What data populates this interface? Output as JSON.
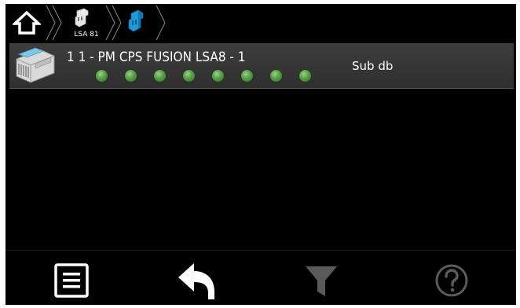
{
  "breadcrumb": {
    "home_icon": "home-icon",
    "device_label": "LSA 81",
    "device_icon": "device-icon",
    "current_icon": "device-icon-selected"
  },
  "list": {
    "rows": [
      {
        "title": "1 1 - PM CPS FUSION LSA8 - 1",
        "status_text": "Sub db",
        "led_count": 8,
        "led_color": "#4f9a40"
      }
    ]
  },
  "toolbar": {
    "menu_icon": "list-menu-icon",
    "back_icon": "back-arrow-icon",
    "filter_icon": "filter-icon",
    "help_icon": "help-icon"
  },
  "colors": {
    "background": "#000000",
    "row_background": "#363636",
    "accent_blue": "#1e9ad6",
    "disabled_gray": "#5a5a5a",
    "text": "#ffffff"
  }
}
